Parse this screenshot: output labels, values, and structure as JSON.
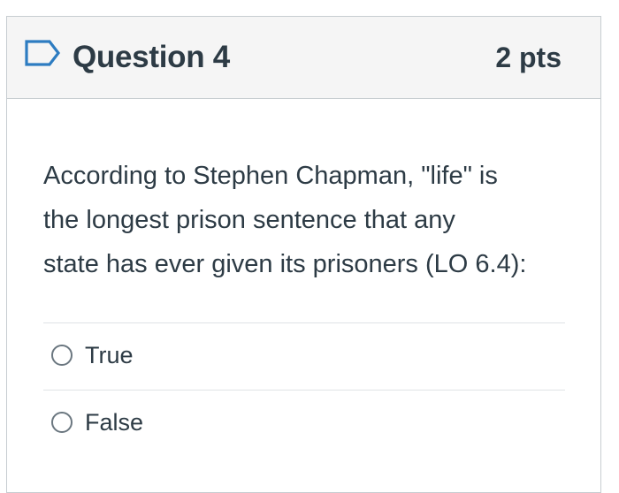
{
  "question": {
    "title": "Question 4",
    "points": "2 pts",
    "flag_icon": "flag-icon",
    "text_lines": [
      "According to Stephen Chapman, \"life\" is",
      "the longest prison sentence that any",
      "state has ever given its prisoners (LO 6.4):"
    ]
  },
  "answers": [
    {
      "label": "True",
      "selected": false
    },
    {
      "label": "False",
      "selected": false
    }
  ],
  "colors": {
    "header_bg": "#f5f5f5",
    "border": "#c7cdd1",
    "text": "#2d3b45",
    "flag": "#2d7cc1"
  }
}
